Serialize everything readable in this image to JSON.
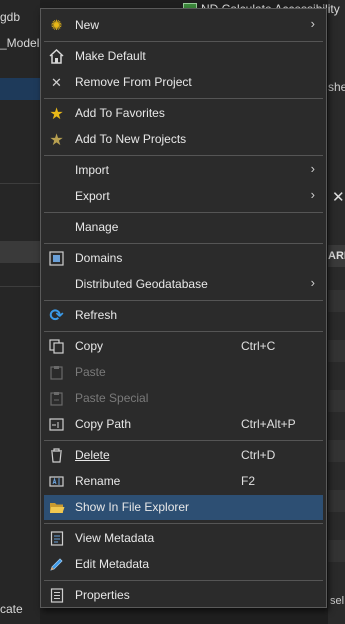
{
  "background": {
    "left_texts": [
      "gdb",
      "_Model."
    ],
    "bottom_left": "cate",
    "top_right_item": "ND Calculate Accessibility",
    "right_snippets": [
      "she",
      "ARI"
    ],
    "bottom_right": "sel"
  },
  "menu": {
    "items": [
      {
        "label": "New",
        "icon": "sun-icon",
        "arrow": true
      },
      {
        "label": "Make Default",
        "icon": "home-icon"
      },
      {
        "label": "Remove From Project",
        "icon": "close-icon"
      },
      {
        "label": "Add To Favorites",
        "icon": "star-icon"
      },
      {
        "label": "Add To New Projects",
        "icon": "star-plus-icon"
      },
      {
        "label": "Import",
        "arrow": true
      },
      {
        "label": "Export",
        "arrow": true
      },
      {
        "label": "Manage"
      },
      {
        "label": "Domains",
        "icon": "domains-icon"
      },
      {
        "label": "Distributed Geodatabase",
        "arrow": true
      },
      {
        "label": "Refresh",
        "icon": "refresh-icon"
      },
      {
        "label": "Copy",
        "icon": "copy-icon",
        "shortcut": "Ctrl+C"
      },
      {
        "label": "Paste",
        "icon": "paste-icon",
        "disabled": true
      },
      {
        "label": "Paste Special",
        "icon": "paste-special-icon",
        "disabled": true
      },
      {
        "label": "Copy Path",
        "icon": "copy-path-icon",
        "shortcut": "Ctrl+Alt+P"
      },
      {
        "label": "Delete",
        "icon": "trash-icon",
        "shortcut": "Ctrl+D"
      },
      {
        "label": "Rename",
        "icon": "rename-icon",
        "shortcut": "F2"
      },
      {
        "label": "Show In File Explorer",
        "icon": "folder-icon",
        "highlighted": true
      },
      {
        "label": "View Metadata",
        "icon": "document-icon"
      },
      {
        "label": "Edit Metadata",
        "icon": "pencil-icon"
      },
      {
        "label": "Properties",
        "icon": "properties-icon"
      }
    ]
  },
  "colors": {
    "highlight": "#2d4f73",
    "star": "#e8b818",
    "refresh": "#3b9ae8",
    "folder": "#e8c04a"
  }
}
